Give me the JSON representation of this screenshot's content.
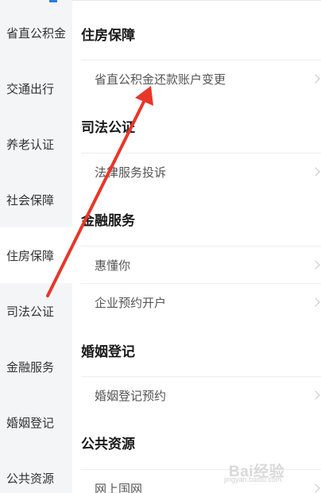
{
  "sidebar": {
    "items": [
      {
        "label": "省直公积金"
      },
      {
        "label": "交通出行"
      },
      {
        "label": "养老认证"
      },
      {
        "label": "社会保障"
      },
      {
        "label": "住房保障"
      },
      {
        "label": "司法公证"
      },
      {
        "label": "金融服务"
      },
      {
        "label": "婚姻登记"
      },
      {
        "label": "公共资源"
      }
    ],
    "active": "住房保障"
  },
  "sections": [
    {
      "title": "住房保障",
      "rows": [
        {
          "label": "省直公积金还款账户变更"
        }
      ]
    },
    {
      "title": "司法公证",
      "rows": [
        {
          "label": "法律服务投诉"
        }
      ]
    },
    {
      "title": "金融服务",
      "rows": [
        {
          "label": "惠懂你"
        },
        {
          "label": "企业预约开户"
        }
      ]
    },
    {
      "title": "婚姻登记",
      "rows": [
        {
          "label": "婚姻登记预约"
        }
      ]
    },
    {
      "title": "公共资源",
      "rows": [
        {
          "label": "网上国网"
        }
      ]
    }
  ],
  "watermark": {
    "logo": "Bai经验",
    "sub": "jingyan.baidu.com"
  },
  "colors": {
    "accent": "#2c7be5",
    "annotation_arrow": "#e8362a",
    "sidebar_bg": "#f4f5f7"
  }
}
